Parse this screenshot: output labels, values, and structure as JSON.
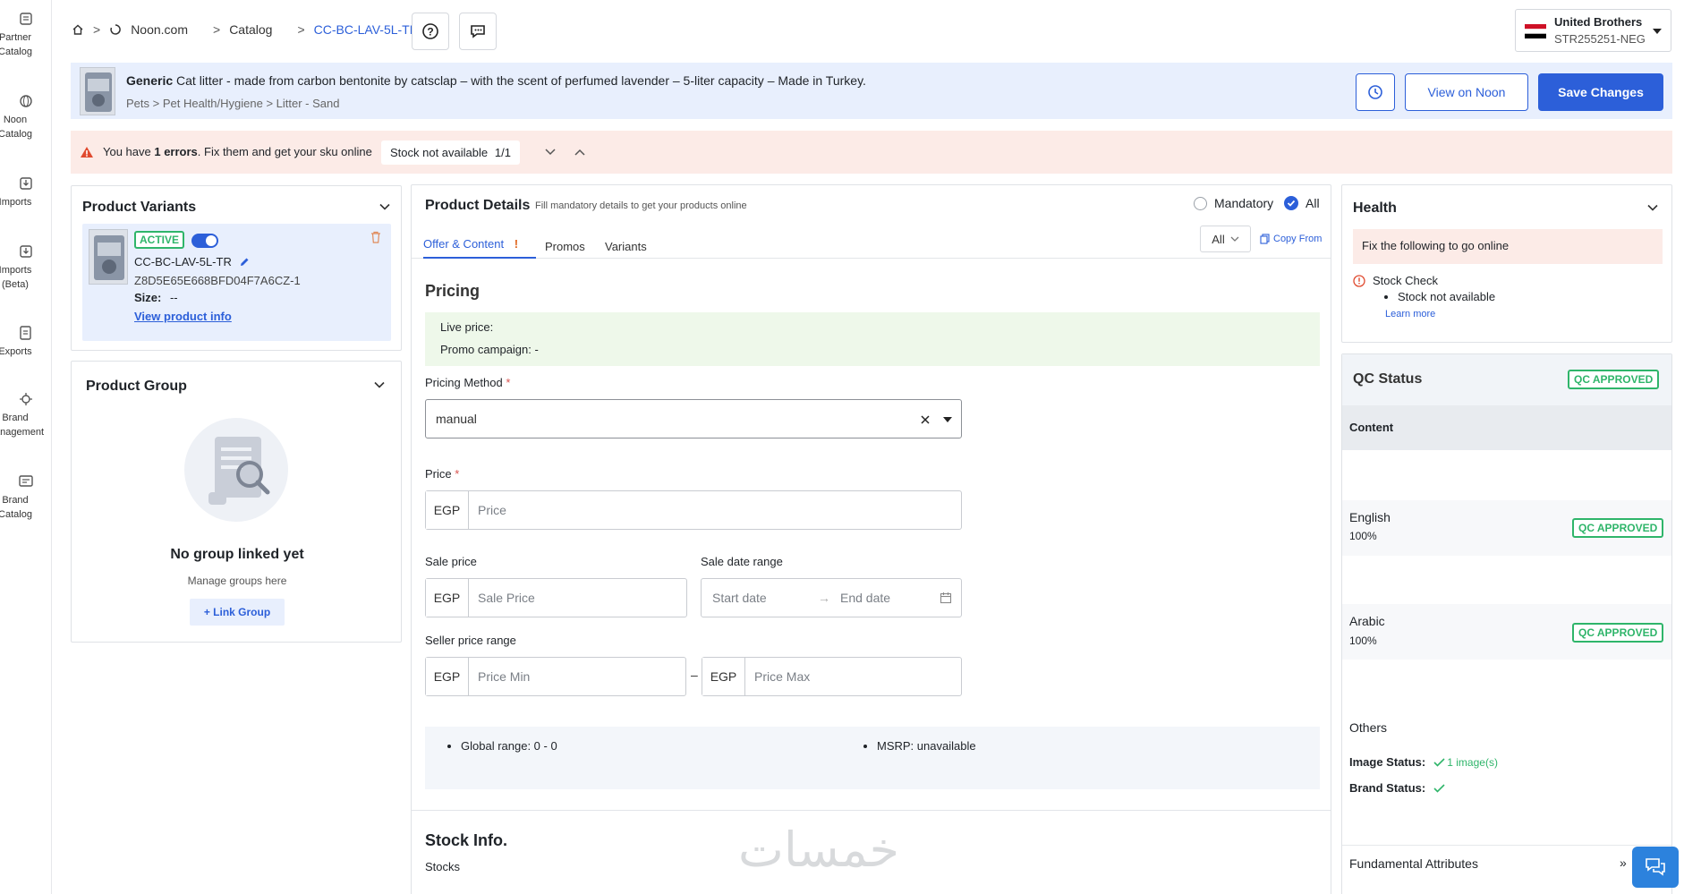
{
  "leftnav": {
    "items": [
      {
        "label": "Partner\nCatalog",
        "icon": "catalog-icon"
      },
      {
        "label": "Noon\nCatalog",
        "icon": "globe-icon"
      },
      {
        "label": "Imports",
        "icon": "import-icon"
      },
      {
        "label": "Imports\n(Beta)",
        "icon": "import-beta-icon"
      },
      {
        "label": "Exports",
        "icon": "export-icon"
      },
      {
        "label": "Brand\nManagement",
        "icon": "brand-icon"
      },
      {
        "label": "Brand\nCatalog",
        "icon": "brand-catalog-icon"
      }
    ]
  },
  "breadcrumb": {
    "items": [
      "Noon.com",
      "Catalog",
      "CC-BC-LAV-5L-TR"
    ]
  },
  "account": {
    "name": "United Brothers",
    "store_code": "STR255251-NEG"
  },
  "product": {
    "brand": "Generic",
    "title": "Cat litter - made from carbon bentonite by catsclap – with the scent of perfumed lavender – 5-liter capacity – Made in Turkey.",
    "category_path": "Pets > Pet Health/Hygiene > Litter - Sand"
  },
  "actions": {
    "view_on_noon": "View on Noon",
    "save_changes": "Save Changes"
  },
  "errors": {
    "prefix": "You have ",
    "count": "1 errors",
    "suffix": ". Fix them and get your sku online",
    "pill_label": "Stock not available",
    "pill_count": "1/1"
  },
  "variants": {
    "title": "Product Variants",
    "status": "ACTIVE",
    "sku": "CC-BC-LAV-5L-TR",
    "id": "Z8D5E65E668BFD04F7A6CZ-1",
    "size_label": "Size:",
    "size_value": "--",
    "view_info": "View product info"
  },
  "group": {
    "title": "Product Group",
    "empty_title": "No group linked yet",
    "empty_sub": "Manage groups here",
    "link_button": "+ Link Group"
  },
  "details": {
    "title": "Product Details",
    "subtitle": "Fill mandatory details to get your products online",
    "filter_mandatory": "Mandatory",
    "filter_all": "All",
    "tabs": [
      {
        "label": "Offer & Content",
        "active": true
      },
      {
        "label": "Promos"
      },
      {
        "label": "Variants"
      }
    ],
    "lang_select": "All",
    "copy_from": "Copy From"
  },
  "pricing": {
    "title": "Pricing",
    "live_price": "Live price:",
    "promo_campaign": "Promo campaign: -",
    "method_label": "Pricing Method",
    "method_value": "manual",
    "price_label": "Price",
    "currency": "EGP",
    "price_ph": "Price",
    "sale_price_label": "Sale price",
    "sale_price_ph": "Sale Price",
    "sale_date_label": "Sale date range",
    "start_date_ph": "Start date",
    "end_date_ph": "End date",
    "seller_range_label": "Seller price range",
    "price_min_ph": "Price Min",
    "price_max_ph": "Price Max",
    "range_sep": "–",
    "global_range": "Global range: 0 - 0",
    "msrp": "MSRP: unavailable"
  },
  "stock": {
    "title": "Stock Info.",
    "stocks_label": "Stocks"
  },
  "health": {
    "title": "Health",
    "fix_text": "Fix the following to go online",
    "check_title": "Stock Check",
    "check_item": "Stock not available",
    "learn_more": "Learn more"
  },
  "qc": {
    "title": "QC Status",
    "badge": "QC APPROVED",
    "content_label": "Content",
    "english_label": "English",
    "english_pct": "100%",
    "arabic_label": "Arabic",
    "arabic_pct": "100%",
    "others_label": "Others",
    "image_status_label": "Image Status:",
    "image_status_value": "1 image(s)",
    "brand_status_label": "Brand Status:",
    "fundamental_label": "Fundamental Attributes",
    "fundamental_arrow": "»"
  },
  "watermark": "خمسات",
  "colors": {
    "primary": "#2c5fd9",
    "success": "#2fb56a",
    "error_bg": "#fcebe7",
    "banner_bg": "#e8effd"
  }
}
